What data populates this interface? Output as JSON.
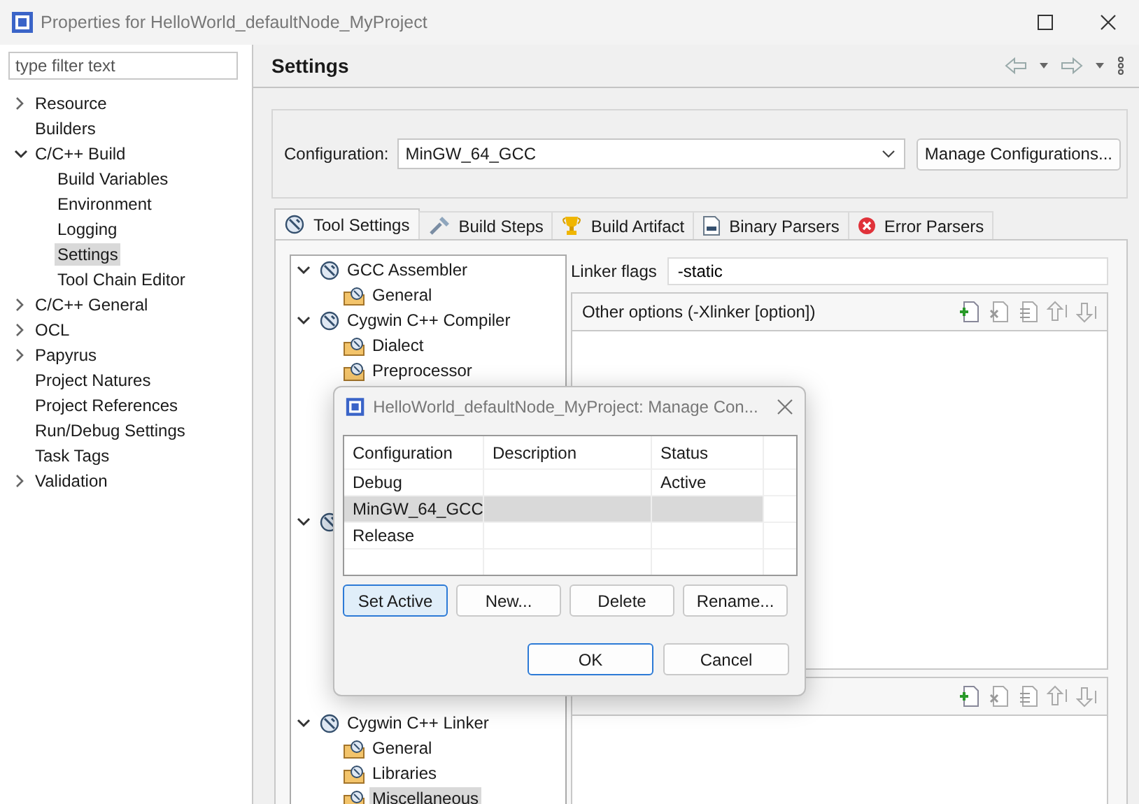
{
  "window": {
    "title": "Properties for HelloWorld_defaultNode_MyProject"
  },
  "filter": {
    "placeholder": "type filter text"
  },
  "nav_tree": [
    {
      "label": "Resource",
      "expanded": false,
      "selected": false
    },
    {
      "label": "Builders",
      "selected": false
    },
    {
      "label": "C/C++ Build",
      "expanded": true,
      "selected": false,
      "children": [
        {
          "label": "Build Variables",
          "selected": false
        },
        {
          "label": "Environment",
          "selected": false
        },
        {
          "label": "Logging",
          "selected": false
        },
        {
          "label": "Settings",
          "selected": true
        },
        {
          "label": "Tool Chain Editor",
          "selected": false
        }
      ]
    },
    {
      "label": "C/C++ General",
      "expanded": false,
      "selected": false
    },
    {
      "label": "OCL",
      "expanded": false,
      "selected": false
    },
    {
      "label": "Papyrus",
      "expanded": false,
      "selected": false
    },
    {
      "label": "Project Natures",
      "selected": false
    },
    {
      "label": "Project References",
      "selected": false
    },
    {
      "label": "Run/Debug Settings",
      "selected": false
    },
    {
      "label": "Task Tags",
      "selected": false
    },
    {
      "label": "Validation",
      "expanded": false,
      "selected": false
    }
  ],
  "page": {
    "title": "Settings"
  },
  "configuration": {
    "label": "Configuration:",
    "value": "MinGW_64_GCC",
    "button": "Manage Configurations..."
  },
  "tabs": [
    {
      "label": "Tool Settings",
      "kind": "tool",
      "selected": true
    },
    {
      "label": "Build Steps",
      "kind": "steps",
      "selected": false
    },
    {
      "label": "Build Artifact",
      "kind": "trophy",
      "selected": false
    },
    {
      "label": "Binary Parsers",
      "kind": "binary",
      "selected": false
    },
    {
      "label": "Error Parsers",
      "kind": "error",
      "selected": false
    }
  ],
  "tool_tree": [
    {
      "label": "GCC Assembler",
      "expanded": true,
      "children": [
        {
          "label": "General",
          "selected": false
        }
      ]
    },
    {
      "label": "Cygwin C++ Compiler",
      "expanded": true,
      "children": [
        {
          "label": "Dialect",
          "selected": false
        },
        {
          "label": "Preprocessor",
          "selected": false
        }
      ]
    },
    {
      "expanded": true
    },
    {
      "label": "Cygwin C++ Linker",
      "expanded": true,
      "children": [
        {
          "label": "General",
          "selected": false
        },
        {
          "label": "Libraries",
          "selected": false
        },
        {
          "label": "Miscellaneous",
          "selected": true
        }
      ]
    }
  ],
  "linker_flags": {
    "label": "Linker flags",
    "value": "-static"
  },
  "option_lists": [
    {
      "title": "Other options (-Xlinker [option])"
    },
    {
      "toolbar": true
    }
  ],
  "dialog": {
    "title": "HelloWorld_defaultNode_MyProject: Manage Con...",
    "columns": [
      "Configuration",
      "Description",
      "Status"
    ],
    "rows": [
      {
        "configuration": "Debug",
        "status": "Active",
        "selected": false
      },
      {
        "configuration": "MinGW_64_GCC",
        "selected": true
      },
      {
        "configuration": "Release",
        "selected": false
      }
    ],
    "buttons": [
      {
        "label": "Set Active",
        "focused": true
      },
      {
        "label": "New...",
        "focused": false
      },
      {
        "label": "Delete",
        "focused": false
      },
      {
        "label": "Rename...",
        "focused": false
      }
    ],
    "footer_buttons": [
      {
        "label": "OK",
        "focused": true
      },
      {
        "label": "Cancel",
        "focused": false
      }
    ]
  }
}
